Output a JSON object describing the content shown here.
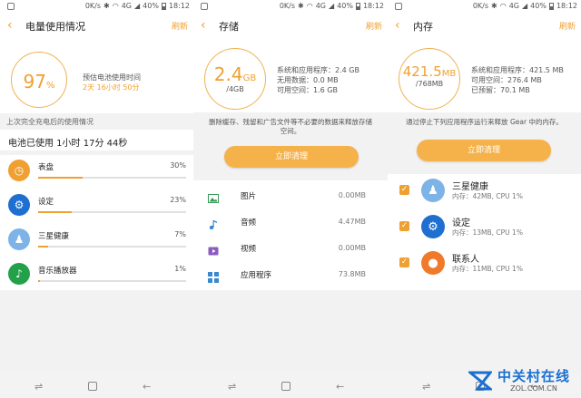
{
  "statusbar": {
    "speed": "0K/s",
    "net": "4G",
    "battery": "40%",
    "time": "18:12"
  },
  "screens": {
    "battery": {
      "title": "电量使用情况",
      "refresh": "刷新",
      "percent": "97",
      "percent_unit": "%",
      "estimate_label": "预估电池使用时间",
      "estimate_value": "2天 16小时 50分",
      "since_label": "上次完全充电后的使用情况",
      "used_label": "电池已使用 1小时 17分 44秒",
      "apps": [
        {
          "name": "表盘",
          "pct": "30%",
          "icon": "watchface-icon",
          "color": "#f0a030",
          "fill": 0.3
        },
        {
          "name": "设定",
          "pct": "23%",
          "icon": "settings-gear-icon",
          "color": "#1e6fd0",
          "fill": 0.23
        },
        {
          "name": "三星健康",
          "pct": "7%",
          "icon": "health-runner-icon",
          "color": "#7db3e6",
          "fill": 0.07
        },
        {
          "name": "音乐播放器",
          "pct": "1%",
          "icon": "music-note-icon",
          "color": "#22a04a",
          "fill": 0.01
        }
      ]
    },
    "storage": {
      "title": "存储",
      "refresh": "刷新",
      "ring_value": "2.4",
      "ring_unit": "GB",
      "ring_total": "/4GB",
      "stats": [
        "系统和应用程序：2.4 GB",
        "无用数据：0.0 MB",
        "可用空间：1.6 GB"
      ],
      "hint": "删除缓存、残留和广告文件等不必要的数据来释放存储空间。",
      "button": "立即清理",
      "items": [
        {
          "name": "图片",
          "size": "0.00MB",
          "icon": "image-icon"
        },
        {
          "name": "音频",
          "size": "4.47MB",
          "icon": "audio-note-icon"
        },
        {
          "name": "视频",
          "size": "0.00MB",
          "icon": "video-icon"
        },
        {
          "name": "应用程序",
          "size": "73.8MB",
          "icon": "apps-grid-icon"
        }
      ]
    },
    "memory": {
      "title": "内存",
      "refresh": "刷新",
      "ring_value": "421.5",
      "ring_unit": "MB",
      "ring_total": "/768MB",
      "stats": [
        "系统和应用程序：421.5 MB",
        "可用空间：276.4 MB",
        "已预留：70.1 MB"
      ],
      "hint": "通过停止下列应用程序运行来释放 Gear 中的内存。",
      "button": "立即清理",
      "apps": [
        {
          "name": "三星健康",
          "sub": "内存：42MB, CPU 1%",
          "icon": "health-runner-icon",
          "color": "#7db3e6"
        },
        {
          "name": "设定",
          "sub": "内存：13MB, CPU 1%",
          "icon": "settings-gear-icon",
          "color": "#1e6fd0"
        },
        {
          "name": "联系人",
          "sub": "内存：11MB, CPU 1%",
          "icon": "contacts-person-icon",
          "color": "#f07a2a"
        }
      ]
    }
  },
  "watermark": {
    "cn": "中关村在线",
    "en": "ZOL.COM.CN"
  }
}
